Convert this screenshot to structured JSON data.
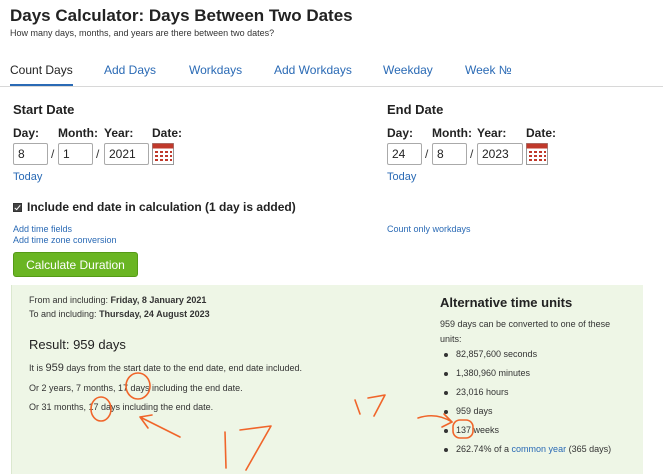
{
  "header": {
    "title": "Days Calculator: Days Between Two Dates",
    "subtitle": "How many days, months, and years are there between two dates?"
  },
  "tabs": [
    {
      "label": "Count Days",
      "active": true
    },
    {
      "label": "Add Days"
    },
    {
      "label": "Workdays"
    },
    {
      "label": "Add Workdays"
    },
    {
      "label": "Weekday"
    },
    {
      "label": "Week №"
    }
  ],
  "start": {
    "title": "Start Date",
    "day_label": "Day:",
    "month_label": "Month:",
    "year_label": "Year:",
    "date_label": "Date:",
    "day": "8",
    "month": "1",
    "year": "2021",
    "today": "Today"
  },
  "end": {
    "title": "End Date",
    "day_label": "Day:",
    "month_label": "Month:",
    "year_label": "Year:",
    "date_label": "Date:",
    "day": "24",
    "month": "8",
    "year": "2023",
    "today": "Today"
  },
  "separator": "/",
  "options": {
    "include_end": "Include end date in calculation (1 day is added)",
    "include_end_checked": true,
    "add_time_fields": "Add time fields",
    "add_time_zone": "Add time zone conversion",
    "count_workdays": "Count only workdays"
  },
  "button": {
    "label": "Calculate Duration"
  },
  "result": {
    "from_prefix": "From and including: ",
    "from_date": "Friday, 8 January 2021",
    "to_prefix": "To and including: ",
    "to_date": "Thursday, 24 August 2023",
    "title": "Result: 959 days",
    "line1_a": "It is ",
    "line1_num": "959",
    "line1_b": " days from the start date to the end date, end date included.",
    "line2": "Or 2 years, 7 months, 17 days including the end date.",
    "line3": "Or 31 months, 17 days including the end date."
  },
  "alternative": {
    "title": "Alternative time units",
    "description": "959 days can be converted to one of these units:",
    "units": [
      "82,857,600 seconds",
      "1,380,960 minutes",
      "23,016 hours",
      "959 days",
      "137 weeks"
    ],
    "percent_prefix": "262.74% of a ",
    "percent_link": "common year",
    "percent_suffix": " (365 days)"
  },
  "annotations": {
    "handwritten_1": "17",
    "handwritten_2": "17",
    "color": "#f0652a"
  }
}
